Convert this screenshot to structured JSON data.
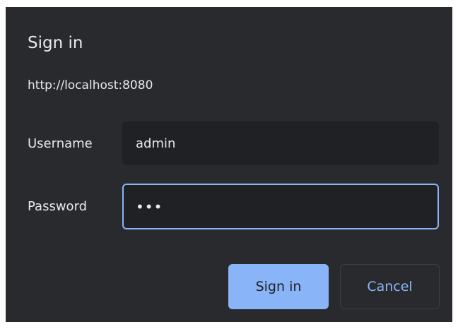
{
  "dialog": {
    "title": "Sign in",
    "origin": "http://localhost:8080",
    "username": {
      "label": "Username",
      "value": "admin"
    },
    "password": {
      "label": "Password",
      "value": "•••"
    },
    "buttons": {
      "sign_in": "Sign in",
      "cancel": "Cancel"
    }
  },
  "colors": {
    "dialog_bg": "#292a2d",
    "field_bg": "#202124",
    "accent": "#8ab4f8",
    "text": "#e8eaed"
  }
}
